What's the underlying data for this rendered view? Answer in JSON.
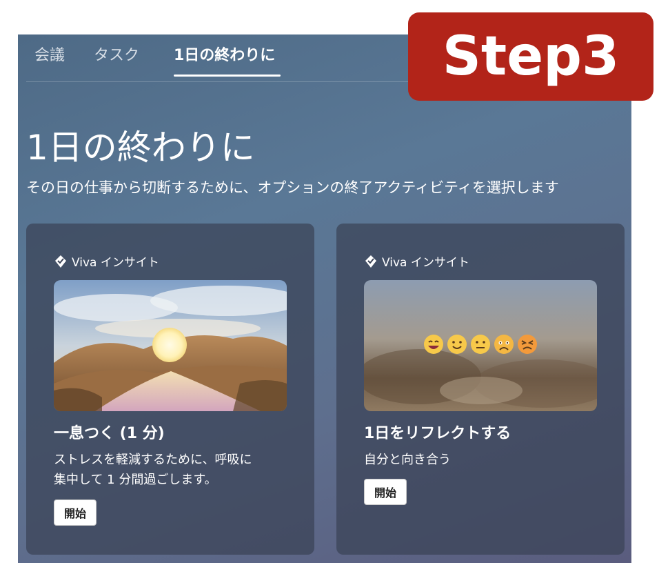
{
  "tabs": {
    "meetings": "会議",
    "tasks": "タスク",
    "end_of_day": "1日の終わりに"
  },
  "header": {
    "title": "1日の終わりに",
    "subtitle": "その日の仕事から切断するために、オプションの終了アクティビティを選択します"
  },
  "cards": [
    {
      "brand": "Viva インサイト",
      "title": "一息つく (1 分)",
      "desc_line1": "ストレスを軽減するために、呼吸に",
      "desc_line2": "集中して 1 分間過ごします。",
      "button": "開始",
      "image_icon": "landscape-sun-image"
    },
    {
      "brand": "Viva インサイト",
      "title": "1日をリフレクトする",
      "desc_line1": "自分と向き合う",
      "button": "開始",
      "image_icon": "mood-emoji-image"
    }
  ],
  "badge": {
    "label": "Step3",
    "color": "#b22419"
  },
  "colors": {
    "panel_top": "#4e6a86",
    "panel_bottom": "#5a5c7e"
  }
}
